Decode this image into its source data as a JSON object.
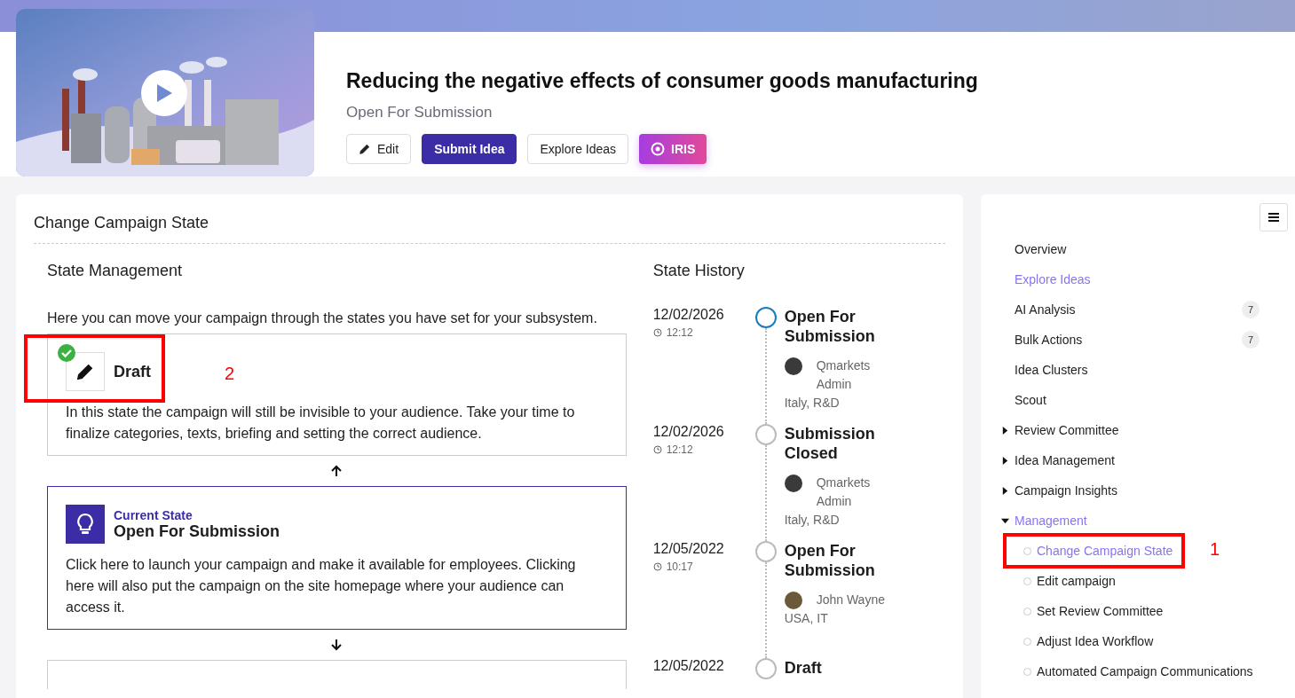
{
  "header": {
    "title": "Reducing the negative effects of consumer goods manufacturing",
    "status": "Open For Submission",
    "buttons": [
      {
        "label": "Edit",
        "kind": "edit"
      },
      {
        "label": "Submit Idea",
        "kind": "primary"
      },
      {
        "label": "Explore Ideas",
        "kind": "outline"
      },
      {
        "label": "IRIS",
        "kind": "iris"
      }
    ]
  },
  "panel": {
    "title": "Change Campaign State"
  },
  "state_management": {
    "heading": "State Management",
    "intro": "Here you can move your campaign through the states you have set for your subsystem.",
    "states": [
      {
        "kind": "draft",
        "name": "Draft",
        "done": true,
        "current": false,
        "description": "In this state the campaign will still be invisible to your audience. Take your time to finalize categories, texts, briefing and setting the correct audience."
      },
      {
        "kind": "up-arrow"
      },
      {
        "kind": "open",
        "label": "Current State",
        "name": "Open For Submission",
        "done": false,
        "current": true,
        "description": "Click here to launch your campaign and make it available for employees. Clicking here will also put the campaign on the site homepage where your audience can access it."
      },
      {
        "kind": "down-arrow"
      },
      {
        "kind": "hidden"
      }
    ]
  },
  "state_history": {
    "heading": "State History",
    "entries": [
      {
        "date": "12/02/2026",
        "time": "12:12",
        "state": "Open For Submission",
        "user": "Qmarkets Admin",
        "location": "Italy, R&D",
        "current": true
      },
      {
        "date": "12/02/2026",
        "time": "12:12",
        "state": "Submission Closed",
        "user": "Qmarkets Admin",
        "location": "Italy, R&D",
        "current": false
      },
      {
        "date": "12/05/2022",
        "time": "10:17",
        "state": "Open For Submission",
        "user": "John Wayne",
        "location": "USA, IT",
        "current": false
      },
      {
        "date": "12/05/2022",
        "state": "Draft",
        "current": false
      }
    ]
  },
  "sidebar": {
    "items": [
      {
        "label": "Overview",
        "selected": false
      },
      {
        "label": "Explore Ideas",
        "selected": true
      },
      {
        "label": "AI Analysis",
        "selected": false,
        "badge": "7"
      },
      {
        "label": "Bulk Actions",
        "selected": false,
        "badge": "7"
      },
      {
        "label": "Idea Clusters",
        "selected": false
      },
      {
        "label": "Scout",
        "selected": false
      },
      {
        "label": "Review Committee",
        "selected": false,
        "expanded": false
      },
      {
        "label": "Idea Management",
        "selected": false,
        "expanded": false
      },
      {
        "label": "Campaign Insights",
        "selected": false,
        "expanded": false
      },
      {
        "label": "Management",
        "selected": true,
        "expanded": true,
        "children": [
          {
            "label": "Change Campaign State",
            "selected": true
          },
          {
            "label": "Edit campaign",
            "selected": false
          },
          {
            "label": "Set Review Committee",
            "selected": false
          },
          {
            "label": "Adjust Idea Workflow",
            "selected": false
          },
          {
            "label": "Automated Campaign Communications",
            "selected": false
          }
        ]
      }
    ]
  },
  "annotations": [
    {
      "label": "2",
      "kind": "draft-frame"
    },
    {
      "label": "1",
      "kind": "sidebar-frame"
    }
  ]
}
